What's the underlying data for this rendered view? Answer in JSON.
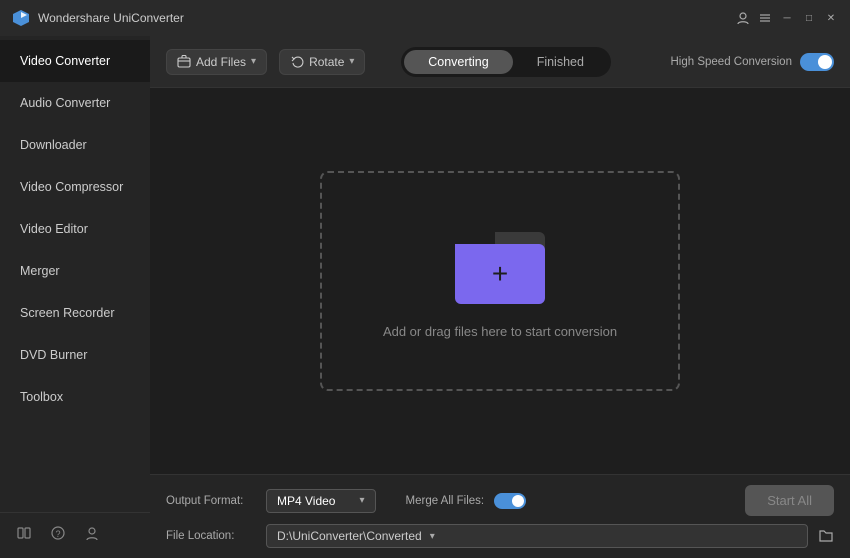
{
  "app": {
    "title": "Wondershare UniConverter",
    "icon": "🎬"
  },
  "titlebar": {
    "user_icon": "👤",
    "menu_icon": "☰",
    "minimize": "─",
    "maximize": "□",
    "close": "✕"
  },
  "sidebar": {
    "items": [
      {
        "id": "video-converter",
        "label": "Video Converter",
        "active": true
      },
      {
        "id": "audio-converter",
        "label": "Audio Converter",
        "active": false
      },
      {
        "id": "downloader",
        "label": "Downloader",
        "active": false
      },
      {
        "id": "video-compressor",
        "label": "Video Compressor",
        "active": false
      },
      {
        "id": "video-editor",
        "label": "Video Editor",
        "active": false
      },
      {
        "id": "merger",
        "label": "Merger",
        "active": false
      },
      {
        "id": "screen-recorder",
        "label": "Screen Recorder",
        "active": false
      },
      {
        "id": "dvd-burner",
        "label": "DVD Burner",
        "active": false
      },
      {
        "id": "toolbox",
        "label": "Toolbox",
        "active": false
      }
    ],
    "bottom_icons": [
      "📚",
      "❓",
      "👤"
    ]
  },
  "toolbar": {
    "add_files_label": "Add Files",
    "rotate_label": "Rotate"
  },
  "tabs": {
    "converting_label": "Converting",
    "finished_label": "Finished",
    "active": "converting"
  },
  "high_speed": {
    "label": "High Speed Conversion",
    "enabled": true
  },
  "drop_zone": {
    "text": "Add or drag files here to start conversion"
  },
  "bottom_bar": {
    "output_format_label": "Output Format:",
    "output_format_value": "MP4 Video",
    "merge_label": "Merge All Files:",
    "file_location_label": "File Location:",
    "file_location_value": "D:\\UniConverter\\Converted",
    "start_all_label": "Start All"
  }
}
